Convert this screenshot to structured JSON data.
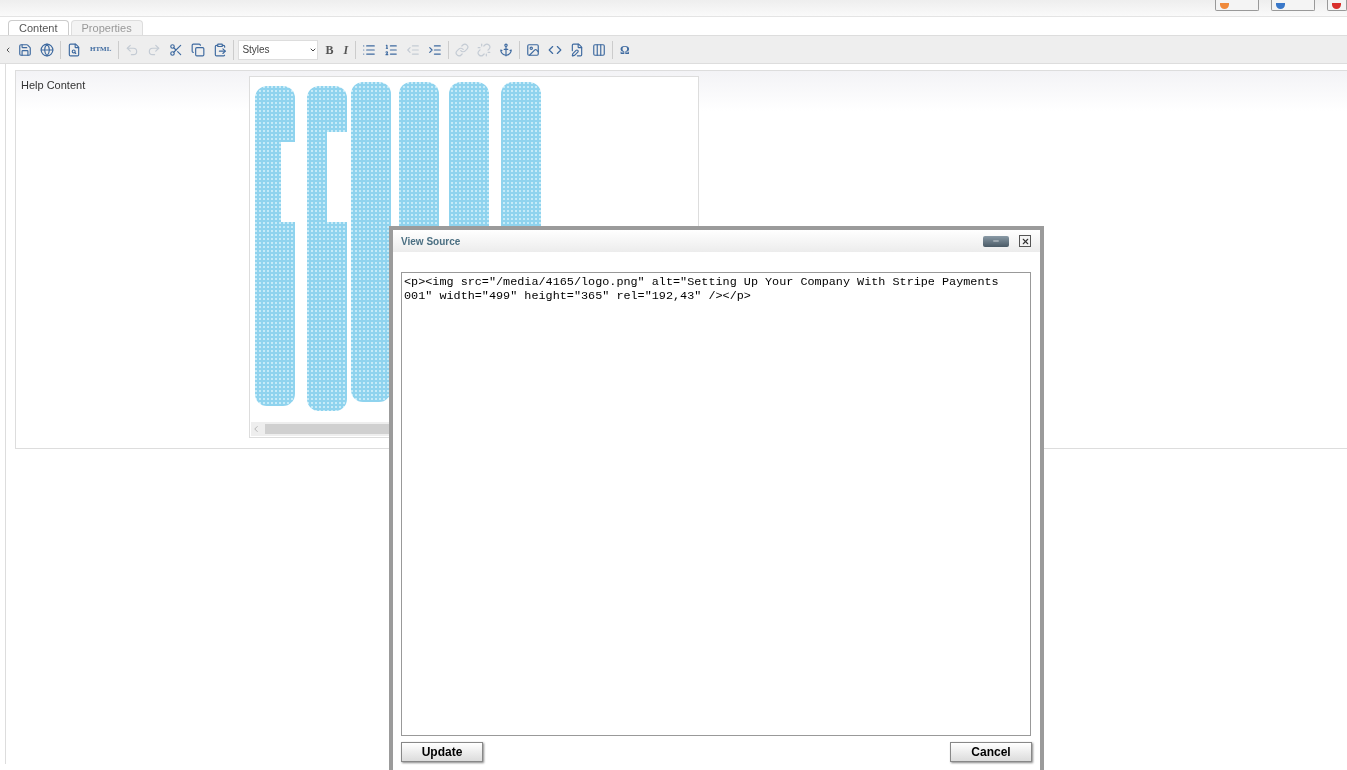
{
  "header_buttons": [
    {
      "color": "#f08a3c"
    },
    {
      "color": "#3a78c9"
    },
    {
      "color": "#d9302c"
    }
  ],
  "tabs": [
    {
      "label": "Content",
      "selected": true
    },
    {
      "label": "Properties",
      "selected": false
    }
  ],
  "toolbar": [
    [
      {
        "kind": "icon",
        "disabled": false
      },
      {
        "kind": "icon",
        "disabled": false
      }
    ],
    [
      {
        "kind": "icon",
        "disabled": false
      },
      {
        "kind": "text",
        "label": "HTML",
        "disabled": false
      }
    ],
    [
      {
        "kind": "icon",
        "disabled": true
      },
      {
        "kind": "icon",
        "disabled": true
      },
      {
        "kind": "icon",
        "disabled": false
      },
      {
        "kind": "icon",
        "disabled": false
      },
      {
        "kind": "icon",
        "disabled": false
      }
    ],
    [
      {
        "kind": "select",
        "label": "Styles",
        "disabled": false
      },
      {
        "kind": "text",
        "label": "B",
        "disabled": false
      },
      {
        "kind": "text",
        "label": "I",
        "disabled": false
      }
    ],
    [
      {
        "kind": "icon",
        "disabled": false
      },
      {
        "kind": "icon",
        "disabled": false
      },
      {
        "kind": "icon",
        "disabled": true
      },
      {
        "kind": "icon",
        "disabled": false
      }
    ],
    [
      {
        "kind": "icon",
        "disabled": true
      },
      {
        "kind": "icon",
        "disabled": true
      },
      {
        "kind": "icon",
        "disabled": false
      }
    ],
    [
      {
        "kind": "icon",
        "disabled": false
      },
      {
        "kind": "icon",
        "disabled": false
      },
      {
        "kind": "icon",
        "disabled": false
      },
      {
        "kind": "icon",
        "disabled": false
      }
    ],
    [
      {
        "kind": "text",
        "label": "Ω",
        "disabled": false
      }
    ]
  ],
  "field": {
    "label": "Help Content"
  },
  "dialog": {
    "title": "View Source",
    "source": "<p><img src=\"/media/4165/logo.png\" alt=\"Setting Up Your Company With Stripe Payments 001\" width=\"499\" height=\"365\" rel=\"192,43\" /></p>",
    "buttons": [
      "Update",
      "Cancel"
    ]
  }
}
